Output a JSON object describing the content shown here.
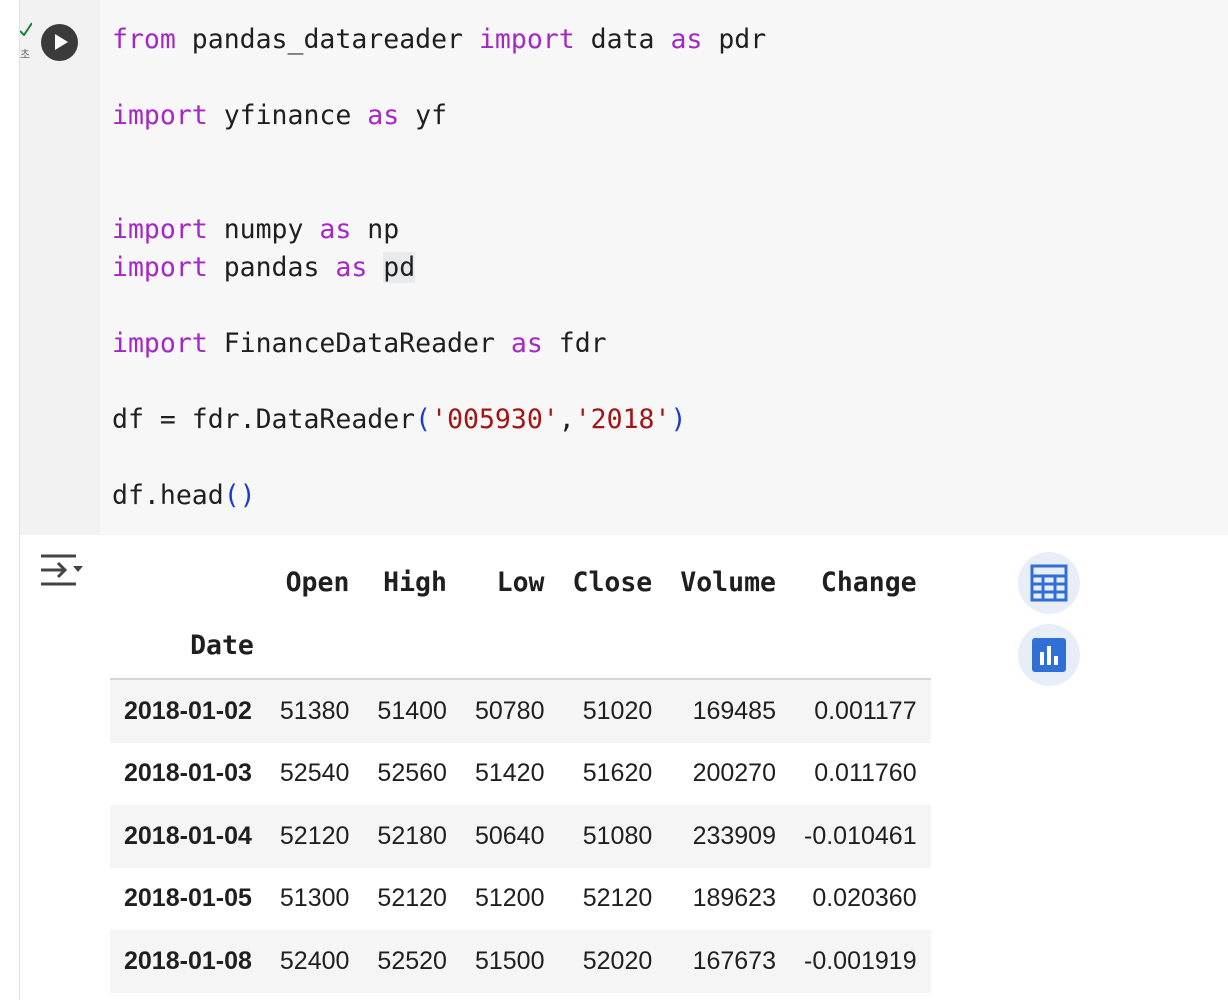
{
  "gutter": {
    "exec_time_label": "초"
  },
  "code_cell": {
    "lines": [
      [
        {
          "t": "from",
          "c": "kw"
        },
        {
          "t": " pandas_datareader "
        },
        {
          "t": "import",
          "c": "kw"
        },
        {
          "t": " data "
        },
        {
          "t": "as",
          "c": "kw"
        },
        {
          "t": " pdr"
        }
      ],
      [],
      [
        {
          "t": "import",
          "c": "kw"
        },
        {
          "t": " yfinance "
        },
        {
          "t": "as",
          "c": "kw"
        },
        {
          "t": " yf"
        }
      ],
      [],
      [],
      [
        {
          "t": "import",
          "c": "kw"
        },
        {
          "t": " numpy "
        },
        {
          "t": "as",
          "c": "kw"
        },
        {
          "t": " np"
        }
      ],
      [
        {
          "t": "import",
          "c": "kw"
        },
        {
          "t": " pandas "
        },
        {
          "t": "as",
          "c": "kw"
        },
        {
          "t": " "
        },
        {
          "t": "pd",
          "c": "sel"
        }
      ],
      [],
      [
        {
          "t": "import",
          "c": "kw"
        },
        {
          "t": " FinanceDataReader "
        },
        {
          "t": "as",
          "c": "kw"
        },
        {
          "t": " fdr"
        }
      ],
      [],
      [
        {
          "t": "df = fdr.DataReader"
        },
        {
          "t": "(",
          "c": "par"
        },
        {
          "t": "'005930'",
          "c": "str"
        },
        {
          "t": ","
        },
        {
          "t": "'2018'",
          "c": "str"
        },
        {
          "t": ")",
          "c": "par"
        }
      ],
      [],
      [
        {
          "t": "df.head"
        },
        {
          "t": "()",
          "c": "par"
        }
      ]
    ]
  },
  "output": {
    "columns": [
      "Open",
      "High",
      "Low",
      "Close",
      "Volume",
      "Change"
    ],
    "index_name": "Date",
    "rows": [
      {
        "date": "2018-01-02",
        "values": [
          "51380",
          "51400",
          "50780",
          "51020",
          "169485",
          "0.001177"
        ]
      },
      {
        "date": "2018-01-03",
        "values": [
          "52540",
          "52560",
          "51420",
          "51620",
          "200270",
          "0.011760"
        ]
      },
      {
        "date": "2018-01-04",
        "values": [
          "52120",
          "52180",
          "50640",
          "51080",
          "233909",
          "-0.010461"
        ]
      },
      {
        "date": "2018-01-05",
        "values": [
          "51300",
          "52120",
          "51200",
          "52120",
          "189623",
          "0.020360"
        ]
      },
      {
        "date": "2018-01-08",
        "values": [
          "52400",
          "52520",
          "51500",
          "52020",
          "167673",
          "-0.001919"
        ]
      }
    ]
  },
  "icons": {
    "run": "play-icon",
    "output_toggle": "output-toggle-icon",
    "table": "table-icon",
    "chart": "bar-chart-icon"
  },
  "colors": {
    "keyword": "#a626c9",
    "string": "#a31515",
    "paren": "#1a3ad8",
    "accent": "#2f6fd6"
  }
}
